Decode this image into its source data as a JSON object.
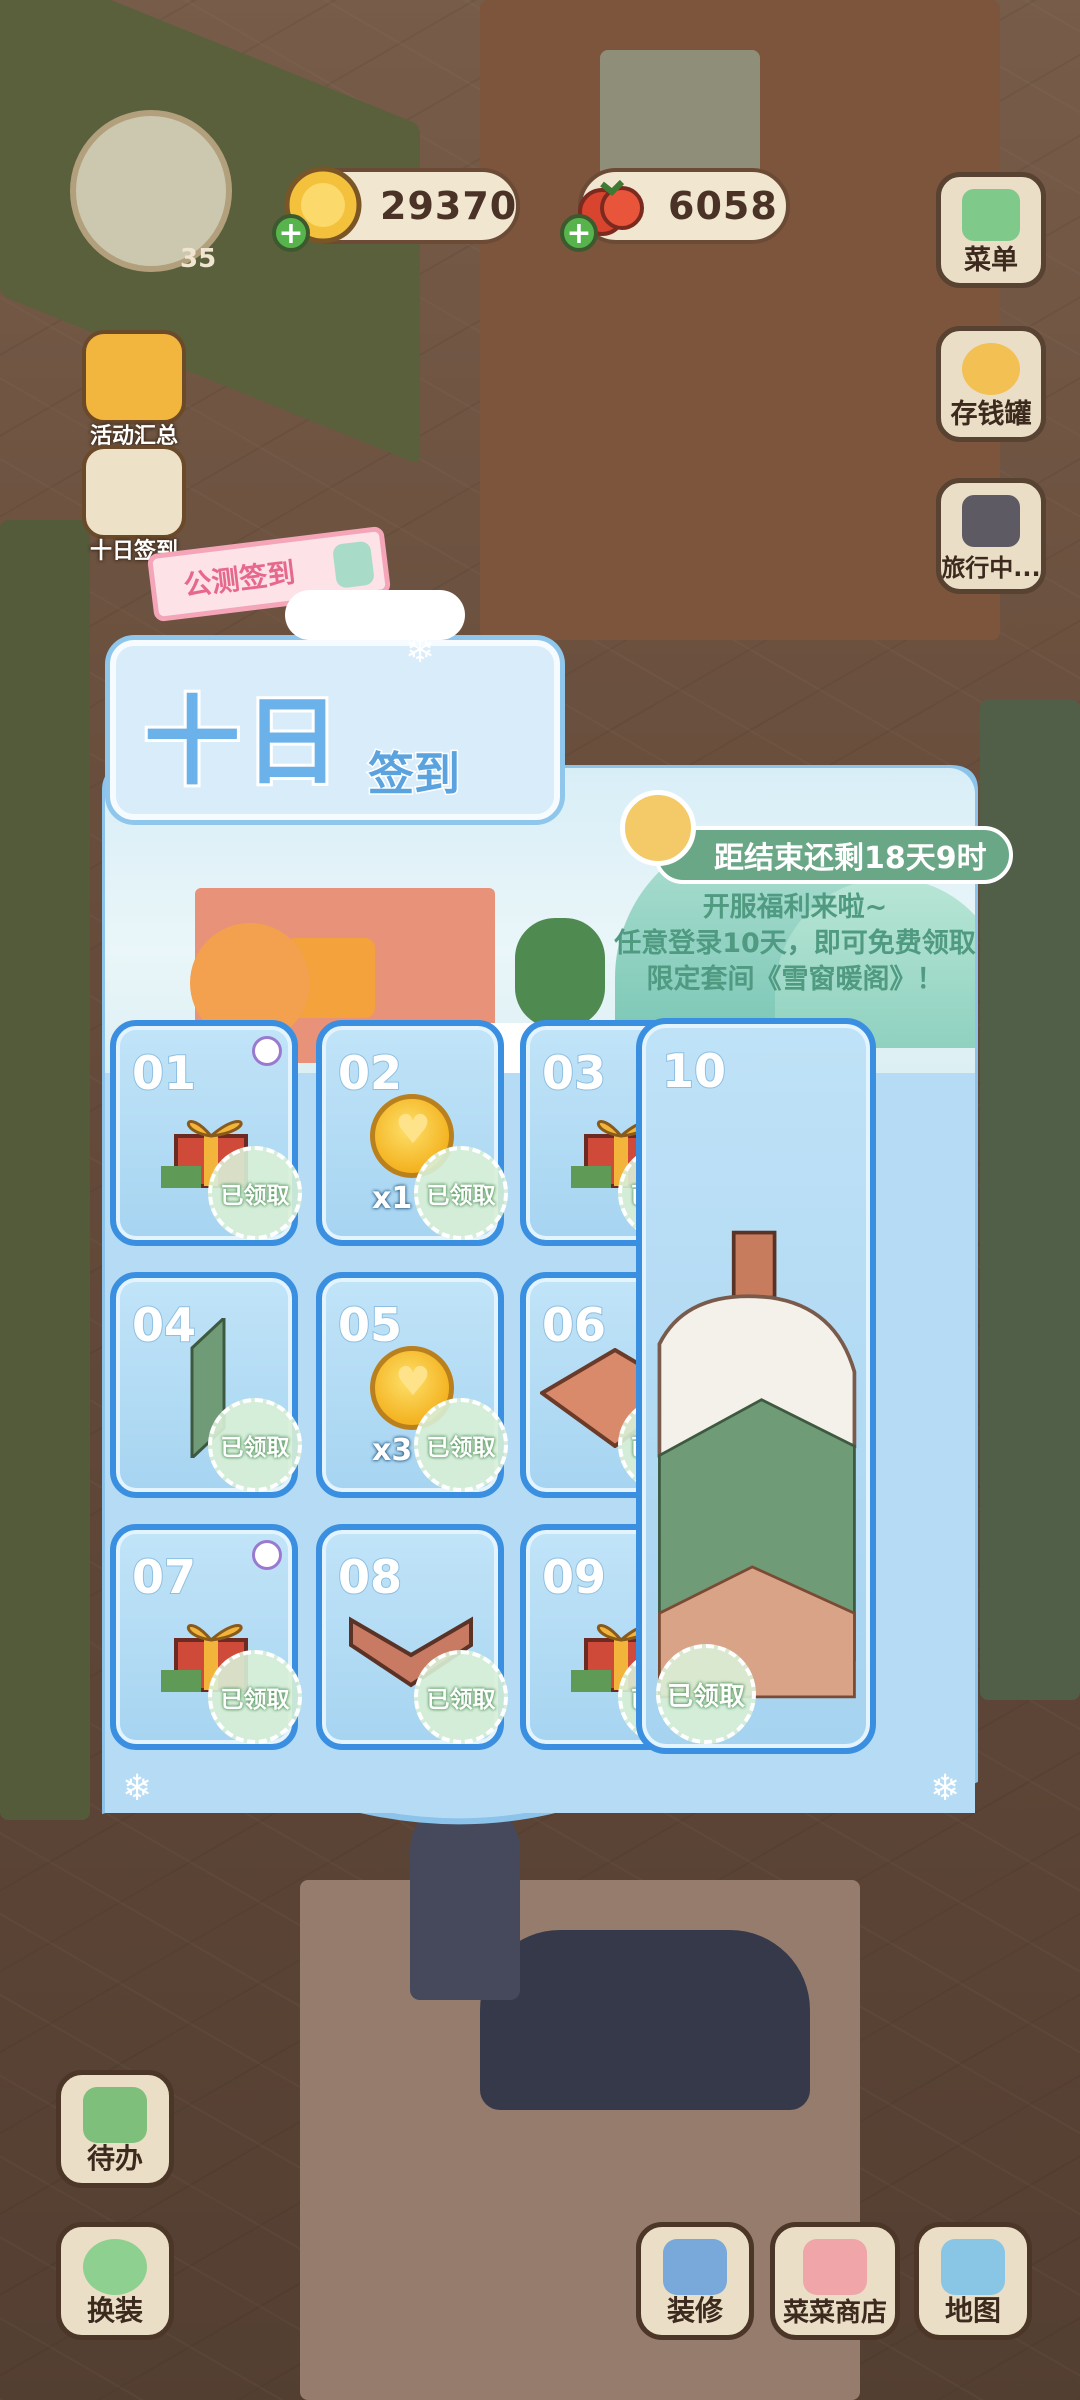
{
  "hud": {
    "coins": "29370",
    "tomatoes": "6058",
    "player_level": "35"
  },
  "left_menu": [
    {
      "label": "活动汇总"
    },
    {
      "label": "十日签到"
    }
  ],
  "right_menu": [
    {
      "label": "菜单"
    },
    {
      "label": "存钱罐"
    },
    {
      "label": "旅行中..."
    }
  ],
  "bottom_bar": {
    "todo": "待办",
    "dressup": "换装",
    "decorate": "装修",
    "shop": "菜菜商店",
    "map": "地图"
  },
  "signin": {
    "tag": "公测签到",
    "title_big": "十日",
    "title_small": "签到",
    "countdown": "距结束还剩18天9时",
    "info_lines": [
      "开服福利来啦~",
      "任意登录10天，即可免费领取",
      "限定套间《雪窗暖阁》！"
    ],
    "claimed_label": "已领取",
    "days": [
      {
        "num": "01",
        "item": "gift-box",
        "qty": ""
      },
      {
        "num": "02",
        "item": "coin",
        "qty": "x1"
      },
      {
        "num": "03",
        "item": "gift-box",
        "qty": ""
      },
      {
        "num": "04",
        "item": "wallpaper",
        "qty": ""
      },
      {
        "num": "05",
        "item": "coin",
        "qty": "x3"
      },
      {
        "num": "06",
        "item": "floor-tile",
        "qty": ""
      },
      {
        "num": "07",
        "item": "gift-box",
        "qty": ""
      },
      {
        "num": "08",
        "item": "corner-wall",
        "qty": ""
      },
      {
        "num": "09",
        "item": "gift-box",
        "qty": ""
      },
      {
        "num": "10",
        "item": "room-set",
        "qty": ""
      }
    ]
  },
  "colors": {
    "cell_border": "#3b8fe0",
    "cell_bg": "#a6d4f1",
    "accent_green": "#6aa787",
    "tag_pink": "#e7688d"
  }
}
